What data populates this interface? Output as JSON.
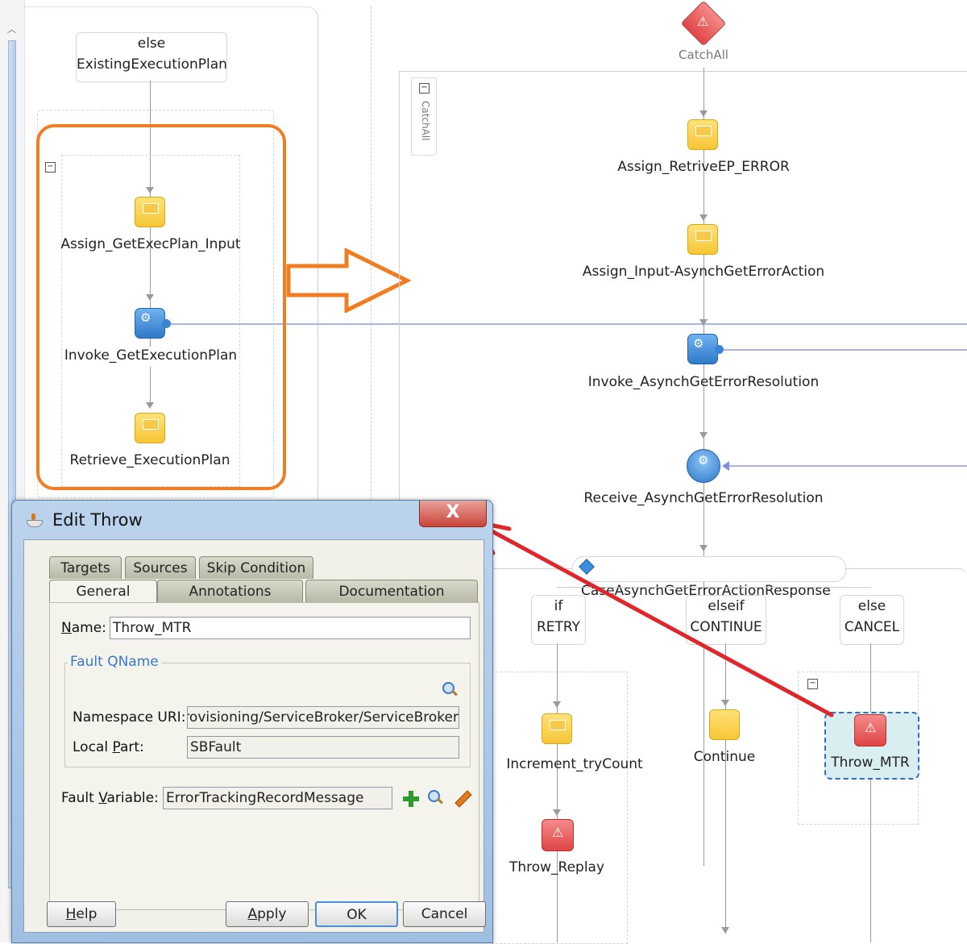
{
  "left_panel": {
    "else_branch": {
      "line1": "else",
      "line2": "ExistingExecutionPlan"
    },
    "nodes": [
      {
        "label": "Assign_GetExecPlan_Input",
        "kind": "assign"
      },
      {
        "label": "Invoke_GetExecutionPlan",
        "kind": "invoke"
      },
      {
        "label": "Retrieve_ExecutionPlan",
        "kind": "assign"
      }
    ]
  },
  "catchall": {
    "label": "CatchAll",
    "scope_label": "CatchAll",
    "nodes": [
      {
        "label": "Assign_RetriveEP_ERROR",
        "kind": "assign"
      },
      {
        "label": "Assign_Input-AsynchGetErrorAction",
        "kind": "assign"
      },
      {
        "label": "Invoke_AsynchGetErrorResolution",
        "kind": "invoke"
      },
      {
        "label": "Receive_AsynchGetErrorResolution",
        "kind": "receive"
      }
    ],
    "switch_label": "CaseAsynchGetErrorActionResponse",
    "branches": [
      {
        "line1": "if",
        "line2": "RETRY"
      },
      {
        "line1": "elseif",
        "line2": "CONTINUE"
      },
      {
        "line1": "else",
        "line2": "CANCEL"
      }
    ],
    "branch_nodes": {
      "increment": "Increment_tryCount",
      "throw_replay": "Throw_Replay",
      "continue": "Continue",
      "throw_mtr": "Throw_MTR"
    }
  },
  "dialog": {
    "title": "Edit Throw",
    "close_glyph": "X",
    "tabs_row1": [
      "Targets",
      "Sources",
      "Skip Condition"
    ],
    "tabs_row2": [
      "General",
      "Annotations",
      "Documentation"
    ],
    "name_label": "Name:",
    "name_value": "Throw_MTR",
    "fault_qname_legend": "Fault QName",
    "namespace_label": "Namespace URI:",
    "namespace_value": "Provisioning/ServiceBroker/ServiceBroker",
    "local_part_label": "Local Part:",
    "local_part_value": "SBFault",
    "fault_variable_label": "Fault Variable:",
    "fault_variable_value": "ErrorTrackingRecordMessage",
    "buttons": {
      "help": "Help",
      "apply": "Apply",
      "ok": "OK",
      "cancel": "Cancel"
    }
  },
  "colors": {
    "highlight_orange": "#f27c22",
    "annotation_red": "#e0262b",
    "assign_yellow": "#f6c636",
    "invoke_blue": "#2f79c9",
    "throw_red": "#df4545",
    "partner_link": "#aab3ee"
  }
}
